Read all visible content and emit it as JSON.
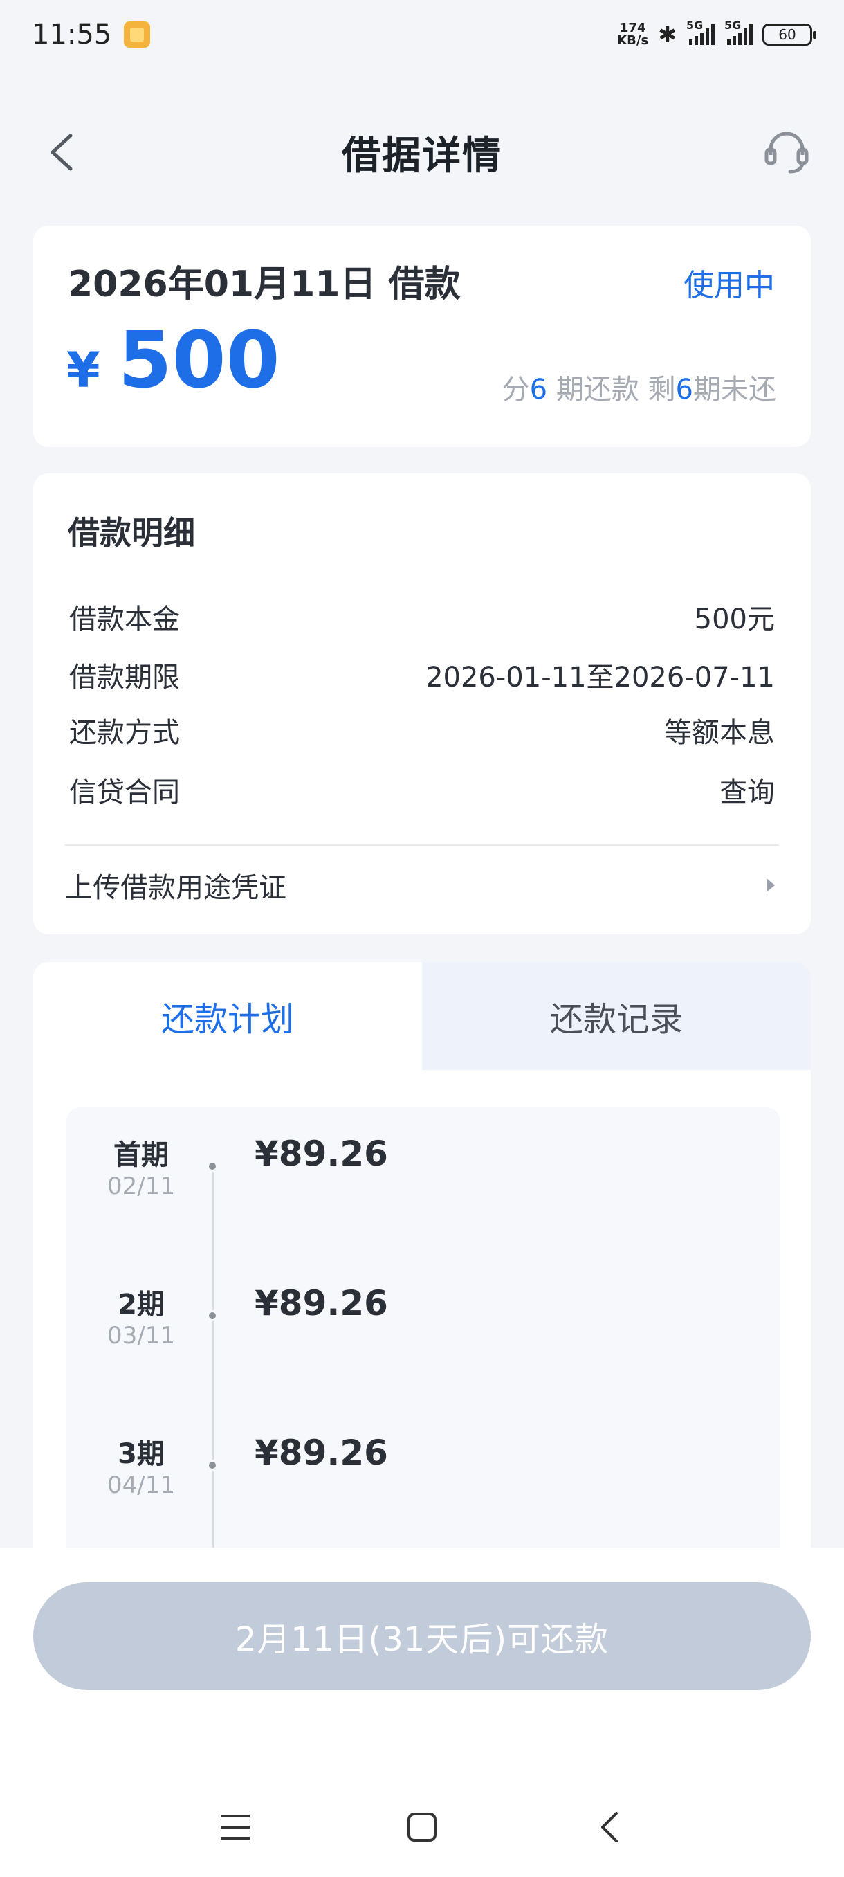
{
  "status_bar": {
    "time": "11:55",
    "net_speed_value": "174",
    "net_speed_unit": "KB/s",
    "signal_1_label": "5G",
    "signal_2_label": "5G",
    "battery": "60"
  },
  "header": {
    "title": "借据详情"
  },
  "loan": {
    "date_label": "2026年01月11日 借款",
    "status": "使用中",
    "currency": "¥",
    "amount": "500",
    "terms_prefix": "分",
    "terms_total": "6",
    "terms_mid": " 期还款 剩",
    "terms_remaining": "6",
    "terms_suffix": "期未还"
  },
  "details": {
    "title": "借款明细",
    "rows": [
      {
        "label": "借款本金",
        "value": "500元"
      },
      {
        "label": "借款期限",
        "value": "2026-01-11至2026-07-11"
      },
      {
        "label": "还款方式",
        "value": "等额本息"
      },
      {
        "label": "信贷合同",
        "value": "查询"
      }
    ],
    "upload_label": "上传借款用途凭证"
  },
  "tabs": [
    {
      "label": "还款计划",
      "active": true
    },
    {
      "label": "还款记录",
      "active": false
    }
  ],
  "schedule": [
    {
      "name": "首期",
      "date": "02/11",
      "amount": "¥89.26"
    },
    {
      "name": "2期",
      "date": "03/11",
      "amount": "¥89.26"
    },
    {
      "name": "3期",
      "date": "04/11",
      "amount": "¥89.26"
    }
  ],
  "repay_button": "2月11日(31天后)可还款",
  "colors": {
    "accent": "#1e6ee8",
    "muted": "#a5aab3",
    "button_disabled": "#c2cbd9"
  }
}
